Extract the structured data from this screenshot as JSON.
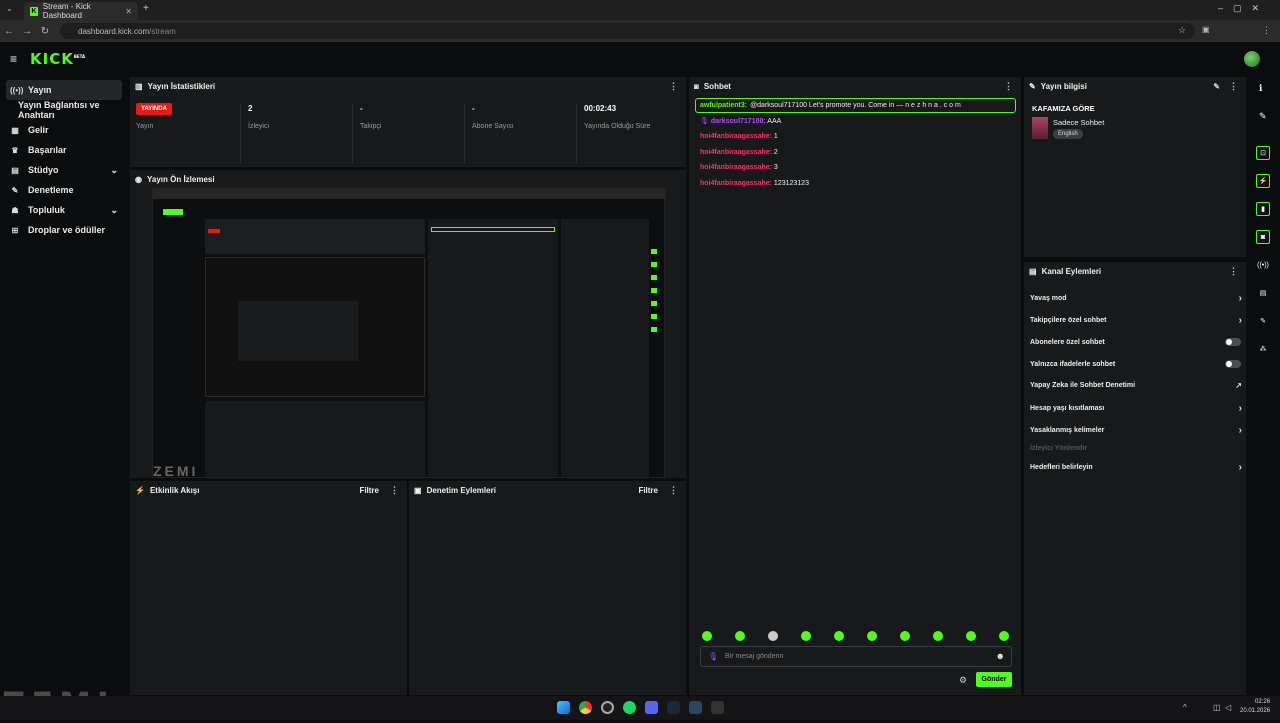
{
  "browser": {
    "tab_title": "Stream - Kick Dashboard",
    "url_host": "dashboard.kick.com",
    "url_path": "/stream"
  },
  "app": {
    "logo": "KICK",
    "logo_badge": "BETA"
  },
  "sidebar": {
    "items": [
      {
        "label": "Yayın",
        "icon": "broadcast-icon"
      },
      {
        "label": "Yayın Bağlantısı ve Anahtarı"
      },
      {
        "label": "Gelir",
        "icon": "money-icon"
      },
      {
        "label": "Başarılar",
        "icon": "trophy-icon"
      },
      {
        "label": "Stüdyo",
        "icon": "studio-icon"
      },
      {
        "label": "Denetleme",
        "icon": "wrench-icon"
      },
      {
        "label": "Topluluk",
        "icon": "community-icon"
      },
      {
        "label": "Droplar ve ödüller",
        "icon": "gift-icon"
      }
    ]
  },
  "stats": {
    "title": "Yayın İstatistikleri",
    "live_badge": "YAYINDA",
    "status_label": "Yayın",
    "viewers_value": "2",
    "viewers_label": "İzleyici",
    "followers_value": "-",
    "followers_label": "Takipçi",
    "subs_value": "-",
    "subs_label": "Abone Sayısı",
    "duration_value": "00:02:43",
    "duration_label": "Yayında Olduğu Süre"
  },
  "preview": {
    "title": "Yayın Ön İzlemesi"
  },
  "activity": {
    "title": "Etkinlik Akışı",
    "filter": "Filtre"
  },
  "moderation": {
    "title": "Denetim Eylemleri",
    "filter": "Filtre"
  },
  "chat": {
    "title": "Sohbet",
    "pinned_user": "awfulpatient3:",
    "pinned_text": "@darksoul717100 Let's promote you. Come in — n e z h n a . c o m",
    "messages": [
      {
        "user": "darksoul717100:",
        "text": "AAA"
      },
      {
        "user": "hoi4fanbiraagassahe:",
        "text": "1"
      },
      {
        "user": "hoi4fanbiraagassahe:",
        "text": "2"
      },
      {
        "user": "hoi4fanbiraagassahe:",
        "text": "3"
      },
      {
        "user": "hoi4fanbiraagassahe:",
        "text": "123123123"
      }
    ],
    "input_placeholder": "Bir mesaj gönderin",
    "send": "Gönder"
  },
  "stream_info": {
    "title": "Yayın bilgisi",
    "stream_title": "KAFAMIZA GÖRE",
    "category": "Sadece Sohbet",
    "language": "English"
  },
  "channel_actions": {
    "title": "Kanal Eylemleri",
    "items": [
      {
        "label": "Yavaş mod",
        "control": "chevron"
      },
      {
        "label": "Takipçilere özel sohbet",
        "control": "chevron"
      },
      {
        "label": "Abonelere özel sohbet",
        "control": "toggle-off"
      },
      {
        "label": "Yalnızca ifadelerle sohbet",
        "control": "toggle-off"
      },
      {
        "label": "Yapay Zeka ile Sohbet Denetimi",
        "control": "external"
      },
      {
        "label": "Hesap yaşı kısıtlaması",
        "control": "chevron"
      },
      {
        "label": "Yasaklanmış kelimeler",
        "control": "chevron"
      },
      {
        "label": "İzleyici Yönlendir",
        "control": "disabled"
      },
      {
        "label": "Hedefleri belirleyin",
        "control": "chevron"
      }
    ]
  },
  "overlay_text": "ZEMI",
  "taskbar": {
    "time": "02:26",
    "date": "20.01.2026"
  },
  "colors": {
    "accent": "#53fc18",
    "live": "#e91916",
    "panel": "#17191b",
    "chat_user": "#ff2e63"
  }
}
